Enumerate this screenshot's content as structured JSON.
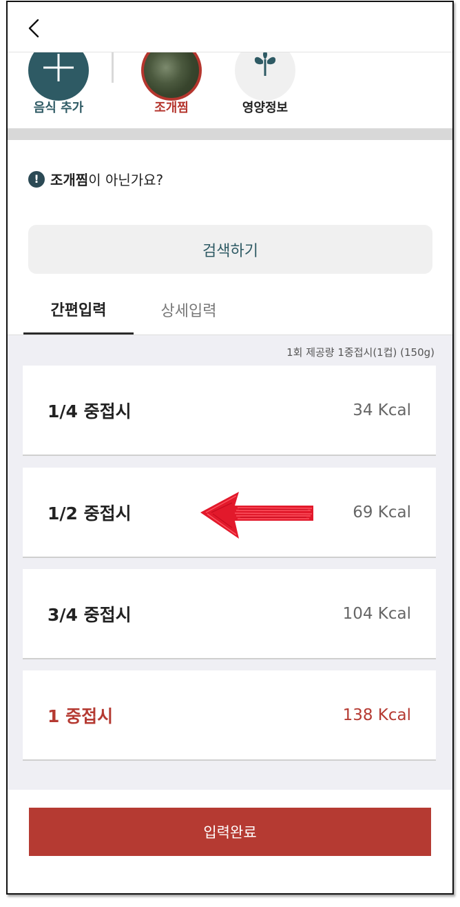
{
  "header": {
    "back_icon": "chevron-left-icon"
  },
  "food_strip": {
    "add_food_label": "음식 추가",
    "dish_label": "조개찜",
    "nutrition_label": "영양정보",
    "colors": {
      "teal": "#2e5a64",
      "red": "#b5362e"
    }
  },
  "notice": {
    "dish_name": "조개찜",
    "suffix": "이 아닌가요?"
  },
  "search_button": {
    "label": "검색하기"
  },
  "tabs": [
    {
      "label": "간편입력",
      "active": true
    },
    {
      "label": "상세입력",
      "active": false
    }
  ],
  "serving_info": "1회 제공량  1중접시(1컵) (150g)",
  "portions": [
    {
      "label": "1/4 중접시",
      "kcal": "34 Kcal"
    },
    {
      "label": "1/2 중접시",
      "kcal": "69 Kcal"
    },
    {
      "label": "3/4 중접시",
      "kcal": "104 Kcal"
    },
    {
      "label": "1 중접시",
      "kcal": "138 Kcal",
      "selected": true
    }
  ],
  "complete_button": {
    "label": "입력완료"
  },
  "accent_color": "#b53a32"
}
